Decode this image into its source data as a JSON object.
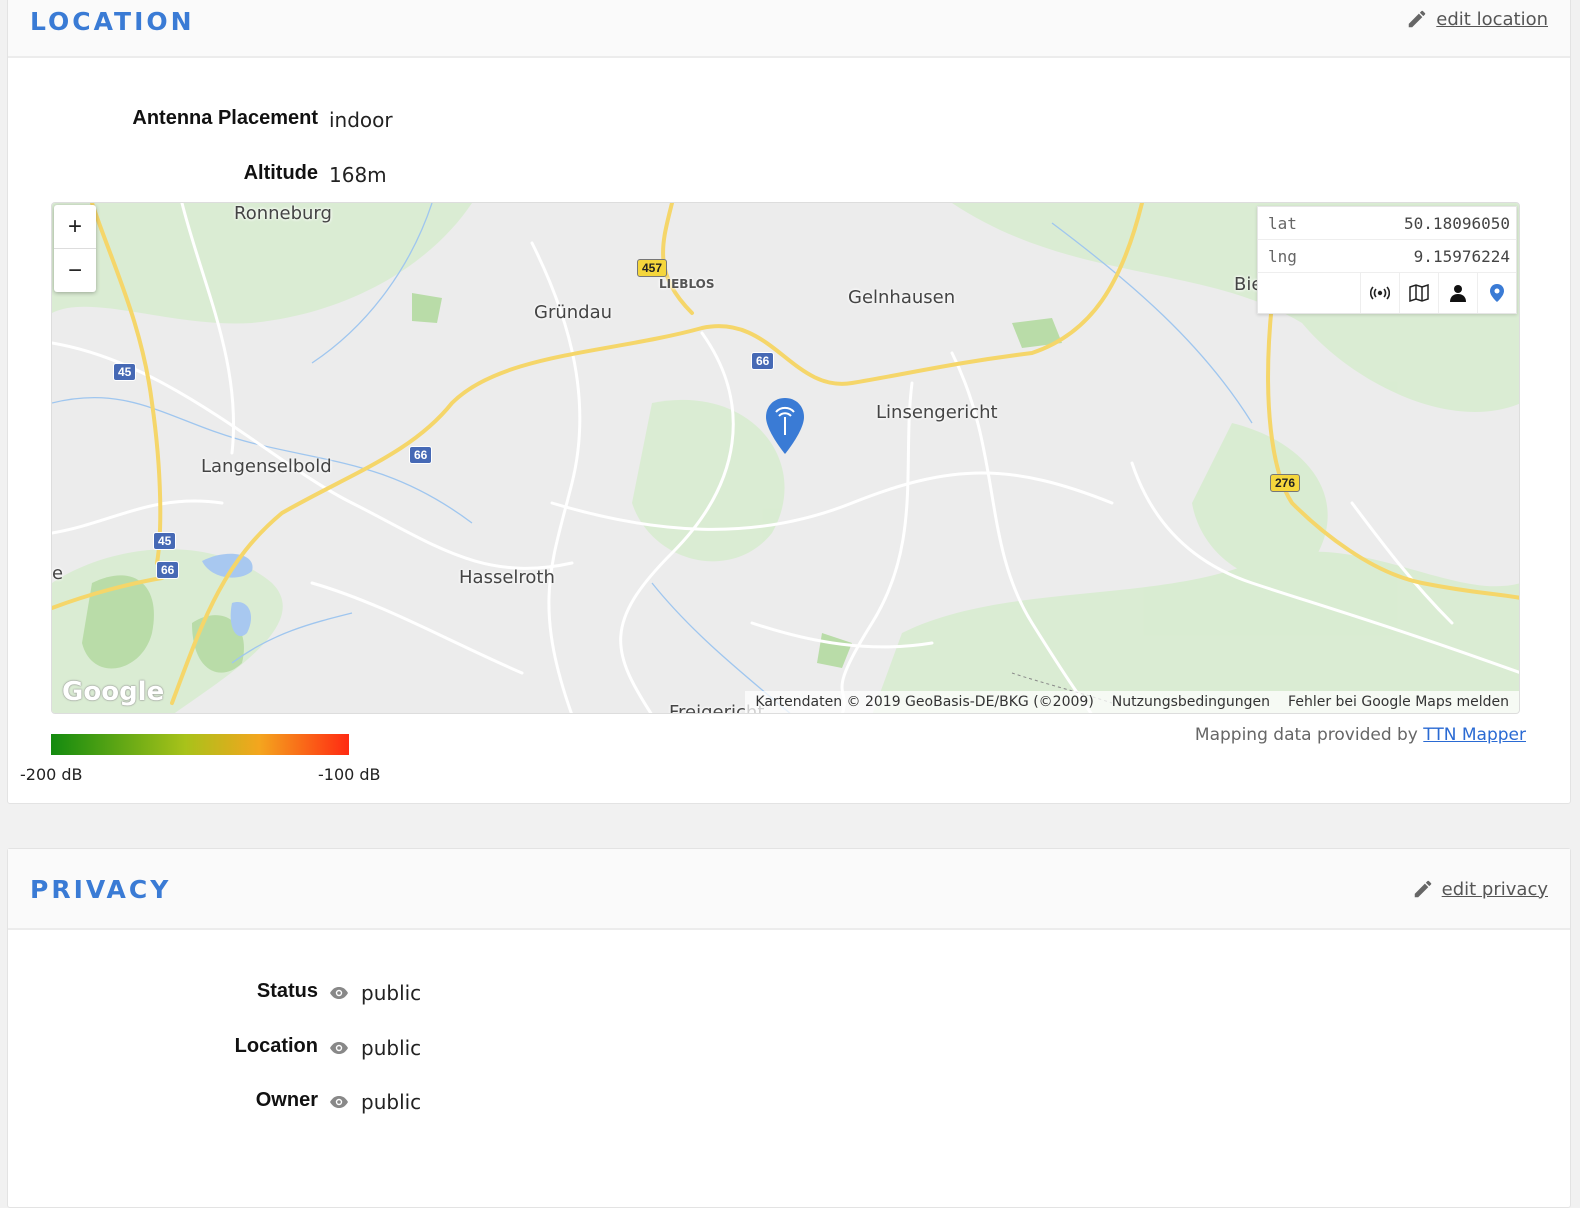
{
  "location": {
    "title": "LOCATION",
    "edit_label": "edit location",
    "fields": [
      {
        "label": "Antenna Placement",
        "value": "indoor"
      },
      {
        "label": "Altitude",
        "value": "168m"
      }
    ],
    "map": {
      "zoom_in": "+",
      "zoom_out": "−",
      "lat_key": "lat",
      "lat_value": "50.18096050",
      "lng_key": "lng",
      "lng_value": "9.15976224",
      "tool_icons": [
        "antenna-icon",
        "map-icon",
        "person-icon",
        "pin-icon"
      ],
      "places": {
        "ronneburg": "Ronneburg",
        "lieblos": "LIEBLOS",
        "gruendau": "Gründau",
        "gelnhausen": "Gelnhausen",
        "bie": "Bie",
        "linsengericht": "Linsengericht",
        "langenselbold": "Langenselbold",
        "hasselroth": "Hasselroth",
        "freigericht": "Freigericht",
        "edge_e": "e"
      },
      "road_shields": {
        "a457": "457",
        "a45_top": "45",
        "a66_center": "66",
        "a66_left": "66",
        "a45_bottom": "45",
        "a66_bottom": "66",
        "b276": "276"
      },
      "google_logo": "Google",
      "attribution": {
        "data": "Kartendaten © 2019 GeoBasis-DE/BKG (©2009)",
        "terms": "Nutzungsbedingungen",
        "report": "Fehler bei Google Maps melden"
      }
    },
    "legend": {
      "min": "-200 dB",
      "max": "-100 dB",
      "colors": [
        "#138a0f",
        "#a8c21a",
        "#f4a51e",
        "#ff2a12"
      ]
    },
    "credit_text": "Mapping data provided by",
    "credit_link": "TTN Mapper"
  },
  "privacy": {
    "title": "PRIVACY",
    "edit_label": "edit privacy",
    "fields": [
      {
        "label": "Status",
        "value": "public"
      },
      {
        "label": "Location",
        "value": "public"
      },
      {
        "label": "Owner",
        "value": "public"
      }
    ]
  },
  "colors": {
    "accent": "#3a7bd5",
    "marker": "#3a7bd5"
  }
}
